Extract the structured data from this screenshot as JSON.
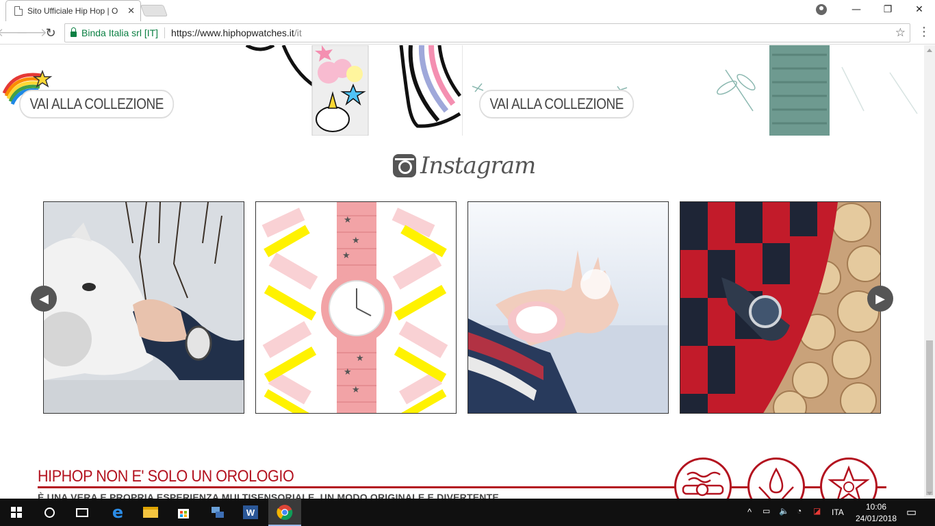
{
  "browser": {
    "tab_title": "Sito Ufficiale Hip Hop | O",
    "tab_close": "✕",
    "secure_label": "Binda Italia srl [IT]",
    "url_host": "https://www.hiphopwatches.it",
    "url_path": "/it",
    "window_controls": {
      "minimize": "—",
      "restore": "❐",
      "close": "✕"
    }
  },
  "banner": {
    "left_cta": "VAI ALLA COLLEZIONE",
    "right_cta": "VAI ALLA COLLEZIONE"
  },
  "instagram": {
    "heading": "Instagram",
    "prev_icon": "◀",
    "next_icon": "▶",
    "posts": [
      {
        "subject": "white-horse-with-watch"
      },
      {
        "subject": "pink-star-watch-on-pattern"
      },
      {
        "subject": "hand-pink-watch-sunlight"
      },
      {
        "subject": "grey-watch-red-sweater-logs"
      }
    ]
  },
  "promo": {
    "title": "HIPHOP NON E' SOLO UN OROLOGIO",
    "subtitle": "È UNA VERA E PROPRIA ESPERIENZA MULTISENSORIALE, UN MODO ORIGINALE E DIVERTENTE",
    "badges": [
      "5atm",
      "scent",
      "star-watch"
    ]
  },
  "taskbar": {
    "language": "ITA",
    "time": "10:06",
    "date": "24/01/2018"
  },
  "colors": {
    "brand_red": "#b3121f",
    "secure_green": "#0b8043",
    "taskbar": "#101010"
  }
}
